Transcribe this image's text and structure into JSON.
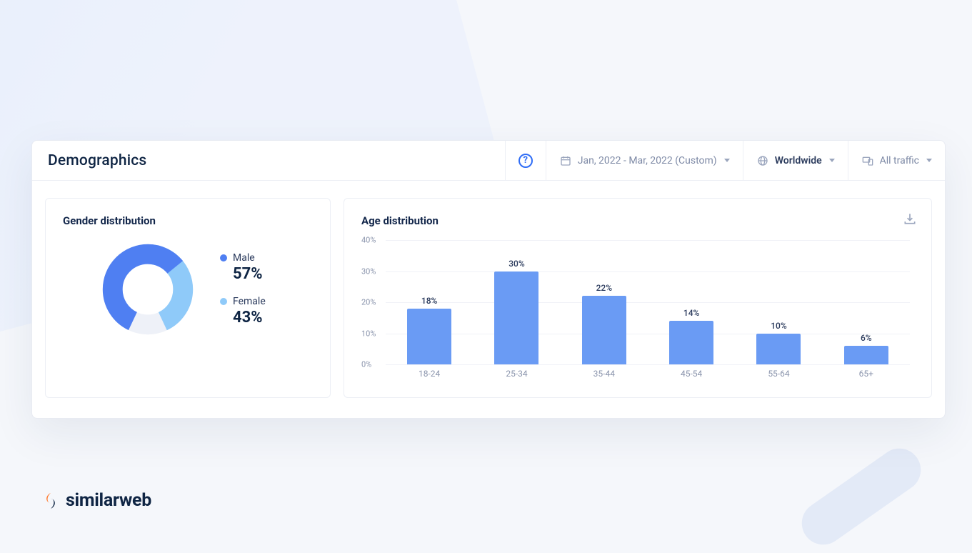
{
  "header": {
    "title": "Demographics",
    "help_tooltip": "?",
    "date_range": "Jan, 2022 - Mar, 2022 (Custom)",
    "region_label": "Worldwide",
    "traffic_label": "All traffic"
  },
  "gender_card": {
    "title": "Gender distribution",
    "male_label": "Male",
    "male_value": "57%",
    "female_label": "Female",
    "female_value": "43%"
  },
  "age_card": {
    "title": "Age distribution"
  },
  "brand": {
    "name": "similarweb"
  },
  "colors": {
    "male": "#4f7ff2",
    "female": "#8fcaf9",
    "bar": "#6a9bf4"
  },
  "chart_data": [
    {
      "type": "pie",
      "title": "Gender distribution",
      "series": [
        {
          "name": "Male",
          "value": 57,
          "color": "#4f7ff2"
        },
        {
          "name": "Female",
          "value": 43,
          "color": "#8fcaf9"
        }
      ]
    },
    {
      "type": "bar",
      "title": "Age distribution",
      "xlabel": "",
      "ylabel": "",
      "ylim": [
        0,
        40
      ],
      "yticks": [
        0,
        10,
        20,
        30,
        40
      ],
      "categories": [
        "18-24",
        "25-34",
        "35-44",
        "45-54",
        "55-64",
        "65+"
      ],
      "values": [
        18,
        30,
        22,
        14,
        10,
        6
      ]
    }
  ]
}
